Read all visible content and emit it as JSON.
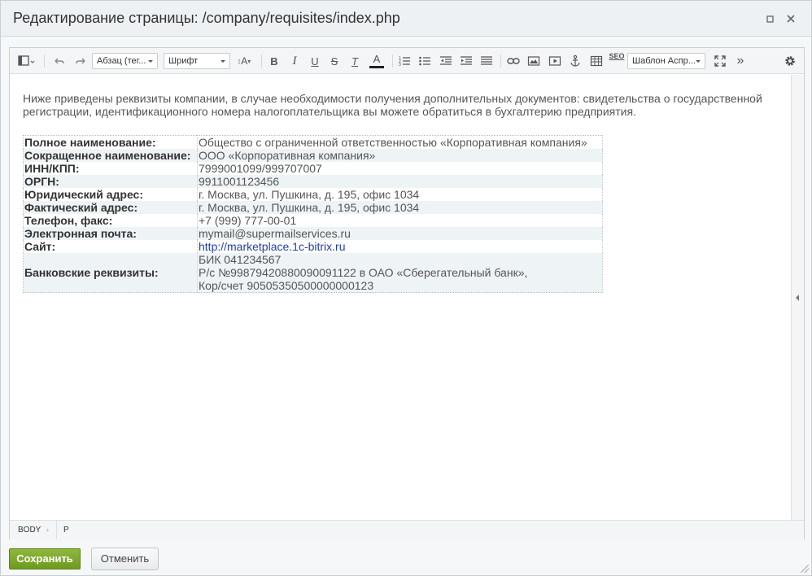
{
  "window": {
    "title": "Редактирование страницы: /company/requisites/index.php"
  },
  "toolbar": {
    "format_select": "Абзац (тег...",
    "font_select": "Шрифт",
    "font_size_label": "A",
    "bold_label": "B",
    "italic_label": "I",
    "underline_label": "U",
    "strike_label": "S",
    "clear_label": "T",
    "color_label": "A",
    "seo_label": "SEO",
    "template_select": "Шаблон Аспр...",
    "more_label": "»"
  },
  "content": {
    "intro": "Ниже приведены реквизиты компании, в случае необходимости получения дополнительных документов: свидетельства о государственной регистрации, идентификационного номера налогоплательщика вы можете обратиться в бухгалтерию предприятия.",
    "rows": [
      {
        "key": "Полное наименование:",
        "value": "Общество с ограниченной ответственностью «Корпоративная компания»"
      },
      {
        "key": "Сокращенное наименование:",
        "value": "ООО «Корпоративная компания»"
      },
      {
        "key": "ИНН/КПП:",
        "value": "7999001099/999707007"
      },
      {
        "key": "ОРГН:",
        "value": "9911001123456"
      },
      {
        "key": "Юридический адрес:",
        "value": "г. Москва, ул. Пушкина, д. 195, офис 1034"
      },
      {
        "key": "Фактический адрес:",
        "value": "г. Москва, ул. Пушкина, д. 195, офис 1034"
      },
      {
        "key": "Телефон, факс:",
        "value": "+7 (999) 777-00-01"
      },
      {
        "key": "Электронная почта:",
        "value": "mymail@supermailservices.ru"
      },
      {
        "key": "Сайт:",
        "value": "http://marketplace.1c-bitrix.ru"
      }
    ],
    "bank": {
      "key": "Банковские реквизиты:",
      "line1": "БИК 041234567",
      "line2": "Р/с №99879420880090091122 в ОАО «Сберегательный банк»,",
      "line3": "Кор/счет 90505350500000000123"
    }
  },
  "statusbar": {
    "crumb_body": "BODY",
    "crumb_arrow": "›",
    "crumb_p": "P"
  },
  "actions": {
    "save_label": "Сохранить",
    "cancel_label": "Отменить"
  },
  "icons": {
    "title_buttons": [
      "maximize-icon",
      "close-icon"
    ],
    "toolbar": [
      "view-mode-icon",
      "undo-icon",
      "redo-icon",
      "font-size-icon",
      "bold-icon",
      "italic-icon",
      "underline-icon",
      "strikethrough-icon",
      "remove-format-icon",
      "text-color-icon",
      "ordered-list-icon",
      "unordered-list-icon",
      "outdent-icon",
      "indent-icon",
      "align-icon",
      "link-icon",
      "image-icon",
      "video-icon",
      "anchor-icon",
      "table-icon",
      "seo-icon",
      "fullscreen-icon",
      "more-icon",
      "settings-icon"
    ]
  },
  "colors": {
    "save_button": "#7aa52a",
    "link": "#1f3fa8"
  }
}
